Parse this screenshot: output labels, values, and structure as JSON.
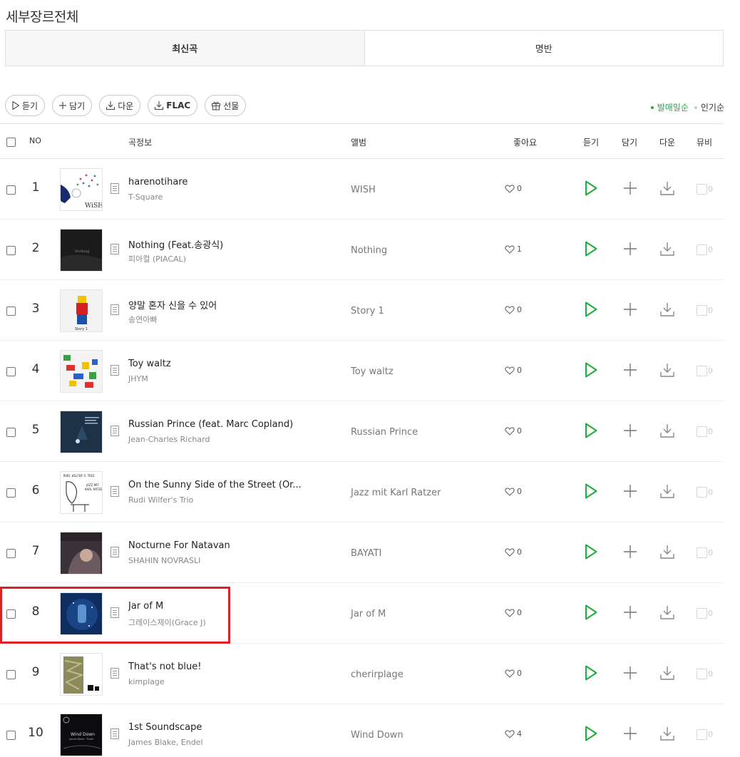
{
  "page": {
    "title": "세부장르전체"
  },
  "tabs": [
    {
      "label": "최신곡",
      "active": true
    },
    {
      "label": "명반",
      "active": false
    }
  ],
  "toolbar": {
    "listen": "듣기",
    "add": "담기",
    "download": "다운",
    "flac": "FLAC",
    "gift": "선물"
  },
  "sort": {
    "by_date": "발매일순",
    "by_popularity": "인기순",
    "active": "by_date"
  },
  "columns": {
    "no": "NO",
    "info": "곡정보",
    "album": "앨범",
    "likes": "좋아요",
    "listen": "듣기",
    "add": "담기",
    "download": "다운",
    "mv": "뮤비"
  },
  "accent_color": "#1fad3c",
  "highlight_color": "#e01e25",
  "highlighted_rank": 8,
  "songs": [
    {
      "rank": "1",
      "title": "harenotihare",
      "artist": "T-Square",
      "album": "WISH",
      "likes": "0",
      "mv": "0"
    },
    {
      "rank": "2",
      "title": "Nothing (Feat.송광식)",
      "artist": "피아컬 (PIACAL)",
      "album": "Nothing",
      "likes": "1",
      "mv": "0"
    },
    {
      "rank": "3",
      "title": "양말 혼자 신을 수 있어",
      "artist": "송연아빠",
      "album": "Story 1",
      "likes": "0",
      "mv": "0"
    },
    {
      "rank": "4",
      "title": "Toy waltz",
      "artist": "JHYM",
      "album": "Toy waltz",
      "likes": "0",
      "mv": "0"
    },
    {
      "rank": "5",
      "title": "Russian Prince (feat. Marc Copland)",
      "artist": "Jean-Charles Richard",
      "album": "Russian Prince",
      "likes": "0",
      "mv": "0"
    },
    {
      "rank": "6",
      "title": "On the Sunny Side of the Street (Or...",
      "artist": "Rudi Wilfer's Trio",
      "album": "Jazz mit Karl Ratzer",
      "likes": "0",
      "mv": "0"
    },
    {
      "rank": "7",
      "title": "Nocturne For Natavan",
      "artist": "SHAHIN NOVRASLI",
      "album": "BAYATI",
      "likes": "0",
      "mv": "0"
    },
    {
      "rank": "8",
      "title": "Jar of M",
      "artist": "그레이스제이(Grace J)",
      "album": "Jar of M",
      "likes": "0",
      "mv": "0"
    },
    {
      "rank": "9",
      "title": "That's not blue!",
      "artist": "kimplage",
      "album": "cherirplage",
      "likes": "0",
      "mv": "0"
    },
    {
      "rank": "10",
      "title": "1st Soundscape",
      "artist": "James Blake, Endel",
      "album": "Wind Down",
      "likes": "4",
      "mv": "0"
    }
  ]
}
